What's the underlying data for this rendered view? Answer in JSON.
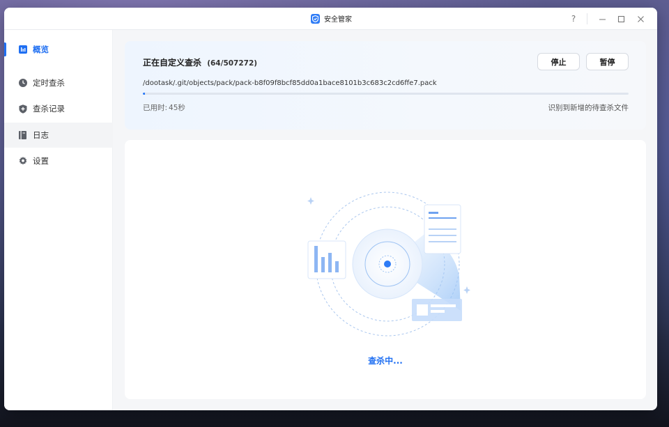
{
  "window": {
    "title": "安全管家",
    "help_symbol": "?"
  },
  "sidebar": {
    "items": [
      {
        "label": "概览",
        "icon": "chart-box-icon",
        "active": true
      },
      {
        "label": "定时查杀",
        "icon": "clock-icon",
        "active": false
      },
      {
        "label": "查杀记录",
        "icon": "shield-plus-icon",
        "active": false
      },
      {
        "label": "日志",
        "icon": "book-icon",
        "active": false
      },
      {
        "label": "设置",
        "icon": "gear-icon",
        "active": false
      }
    ]
  },
  "scan": {
    "title": "正在自定义查杀",
    "count": "(64/507272)",
    "current_path": "/dootask/.git/objects/pack/pack-b8f09f8bcf85dd0a1bace8101b3c683c2cd6ffe7.pack",
    "progress_fraction": 0.0001,
    "elapsed_label": "已用时:",
    "elapsed_value": "45秒",
    "status_note": "识别到新增的待查杀文件",
    "stop_label": "停止",
    "pause_label": "暂停"
  },
  "main": {
    "scanning_text": "查杀中..."
  },
  "colors": {
    "accent": "#1f6ff2",
    "window_bg": "#f5f6f8"
  }
}
